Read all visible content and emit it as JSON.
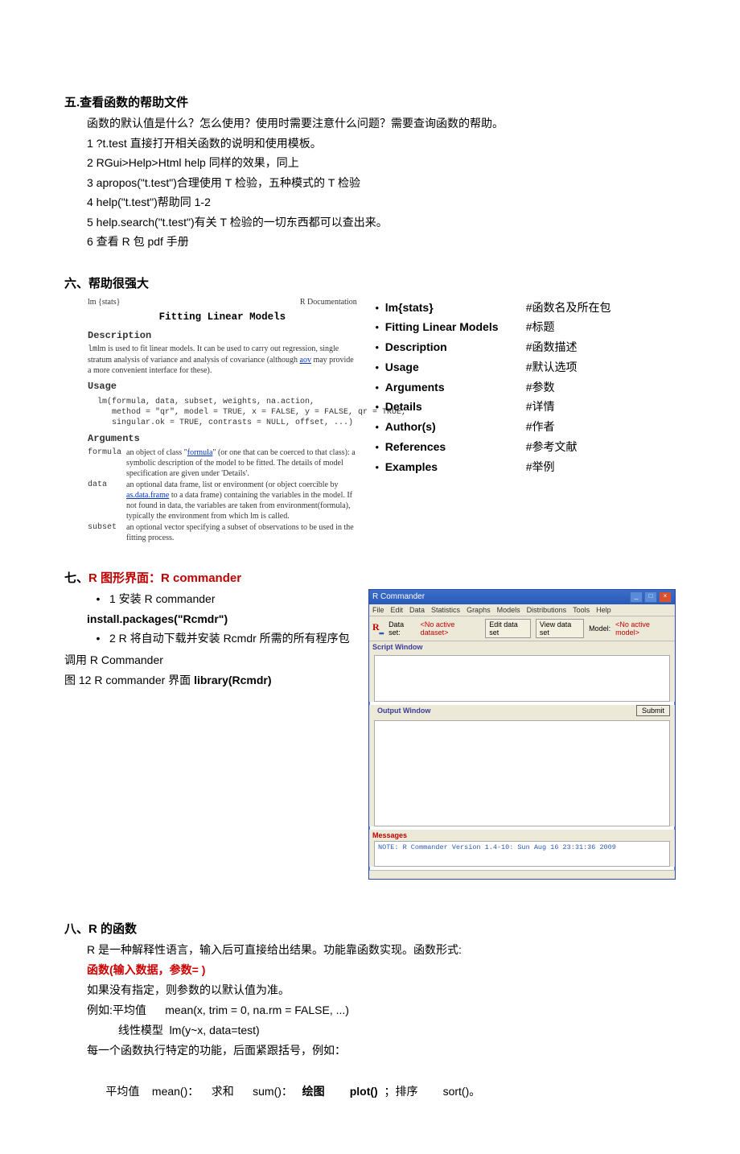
{
  "section5": {
    "heading": "五.查看函数的帮助文件",
    "intro": "函数的默认值是什么？怎么使用？使用时需要注意什么问题？需要查询函数的帮助。",
    "items": [
      "1 ?t.test 直接打开相关函数的说明和使用模板。",
      "2 RGui>Help>Html help 同样的效果，同上",
      "3 apropos(\"t.test\")合理使用 T 检验，五种模式的 T 检验",
      "4 help(\"t.test\")帮助同 1-2",
      "5 help.search(\"t.test\")有关 T 检验的一切东西都可以查出来。",
      "6  查看 R 包 pdf 手册"
    ]
  },
  "section6": {
    "heading": "六、帮助很强大",
    "docbox": {
      "topleft": "lm {stats}",
      "topright": "R Documentation",
      "title": "Fitting Linear Models",
      "desc_h": "Description",
      "desc_p1": "lm is used to fit linear models. It can be used to carry out regression, single stratum analysis of variance and analysis of covariance (although ",
      "desc_link": "aov",
      "desc_p2": " may provide a more convenient interface for these).",
      "usage_h": "Usage",
      "usage_code": "lm(formula, data, subset, weights, na.action,\n   method = \"qr\", model = TRUE, x = FALSE, y = FALSE, qr = TRUE,\n   singular.ok = TRUE, contrasts = NULL, offset, ...)",
      "args_h": "Arguments",
      "args": [
        {
          "name": "formula",
          "desc1": "an object of class \"",
          "link": "formula",
          "desc2": "\" (or one that can be coerced to that class): a symbolic description of the model to be fitted. The details of model specification are given under 'Details'."
        },
        {
          "name": "data",
          "desc1": "an optional data frame, list or environment (or object coercible by ",
          "link": "as.data.frame",
          "desc2": " to a data frame) containing the variables in the model. If not found in data, the variables are taken from environment(formula), typically the environment from which lm is called."
        },
        {
          "name": "subset",
          "desc1": "an optional vector specifying a subset of observations to be used in the fitting process.",
          "link": "",
          "desc2": ""
        }
      ]
    },
    "rightlist": [
      {
        "label": "lm{stats}",
        "comment": "#函数名及所在包"
      },
      {
        "label": "Fitting Linear Models",
        "comment": "#标题"
      },
      {
        "label": "Description",
        "comment": "#函数描述"
      },
      {
        "label": "Usage",
        "comment": "#默认选项"
      },
      {
        "label": "Arguments",
        "comment": "#参数"
      },
      {
        "label": "Details",
        "comment": "#详情"
      },
      {
        "label": "Author(s)",
        "comment": "#作者"
      },
      {
        "label": "References",
        "comment": "#参考文献"
      },
      {
        "label": "Examples",
        "comment": "#举例"
      }
    ]
  },
  "section7": {
    "heading_pre": "七、",
    "heading_red": "R 图形界面：R commander",
    "item1": "1 安装 R commander",
    "install": "install.packages(\"Rcmdr\")",
    "item2": "2 R 将自动下载并安装 Rcmdr 所需的所有程序包",
    "call": "调用 R Commander",
    "fig_pre": "图 12 R commander 界面 ",
    "fig_bold": "library(Rcmdr)",
    "rcmdr": {
      "title": "R Commander",
      "menus": [
        "File",
        "Edit",
        "Data",
        "Statistics",
        "Graphs",
        "Models",
        "Distributions",
        "Tools",
        "Help"
      ],
      "tb_dataset": "Data set:",
      "tb_no_ds": "<No active dataset>",
      "tb_edit": "Edit data set",
      "tb_view": "View data set",
      "tb_model": "Model:",
      "tb_no_model": "<No active model>",
      "scriptw": "Script Window",
      "submit": "Submit",
      "outputw": "Output Window",
      "messages": "Messages",
      "note": "NOTE: R Commander Version 1.4-10: Sun Aug 16 23:31:36 2009"
    }
  },
  "section8": {
    "heading": "八、R 的函数",
    "line1": "R 是一种解释性语言，输入后可直接给出结果。功能靠函数实现。函数形式:",
    "form": "函数(输入数据，参数= )",
    "line3": "如果没有指定，则参数的以默认值为准。",
    "line4": "例如:平均值      mean(x, trim = 0, na.rm = FALSE, ...)",
    "line5": "          线性模型  lm(y~x, data=test)",
    "line6": "每一个函数执行特定的功能，后面紧跟括号，例如：",
    "line7_parts": {
      "a": "平均值    mean()：    求和      sum()：   ",
      "b_bold": "绘图        plot()",
      "c": "  ；排序        sort()。"
    }
  }
}
